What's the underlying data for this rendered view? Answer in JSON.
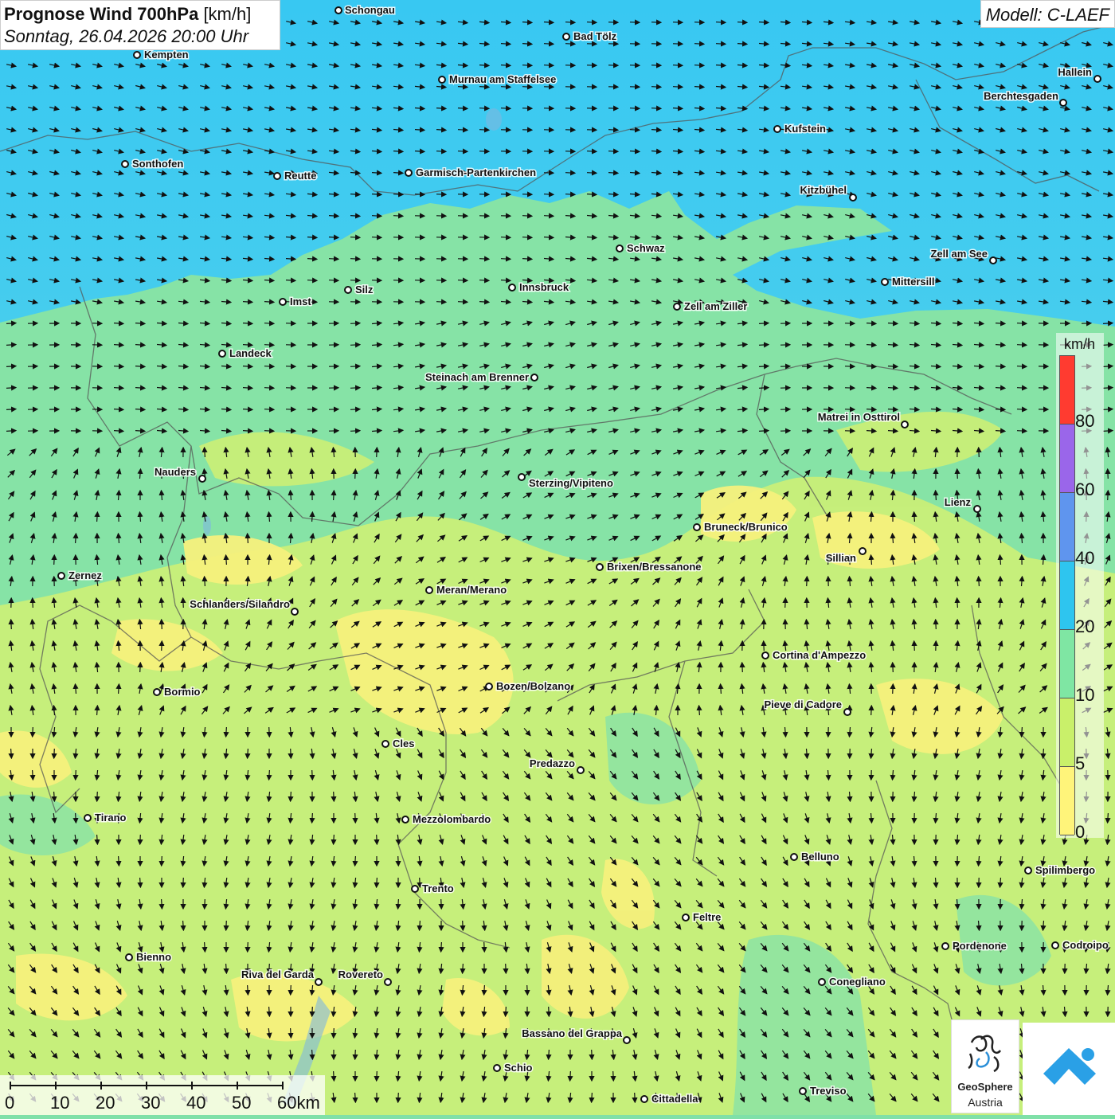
{
  "title": {
    "main": "Prognose Wind 700hPa",
    "unit": "[km/h]",
    "date": "Sonntag, 26.04.2026 20:00 Uhr"
  },
  "model": "Modell: C-LAEF",
  "legend": {
    "unit": "km/h",
    "labels": [
      "80",
      "60",
      "40",
      "20",
      "10",
      "5",
      "0"
    ],
    "colors": [
      "#ff3b30",
      "#9a66ea",
      "#5f95ee",
      "#2ec5ef",
      "#7fe6a3",
      "#c9f06a",
      "#fff47a"
    ]
  },
  "scale_bar": {
    "labels": [
      "0",
      "10",
      "20",
      "30",
      "40",
      "50",
      "60km"
    ]
  },
  "cities": [
    {
      "name": "Schongau"
    },
    {
      "name": "Bad Tölz"
    },
    {
      "name": "Kempten"
    },
    {
      "name": "Murnau am Staffelsee"
    },
    {
      "name": "Hallein"
    },
    {
      "name": "Berchtesgaden"
    },
    {
      "name": "Kufstein"
    },
    {
      "name": "Sonthofen"
    },
    {
      "name": "Reutte"
    },
    {
      "name": "Garmisch-Partenkirchen"
    },
    {
      "name": "Kitzbühel"
    },
    {
      "name": "Schwaz"
    },
    {
      "name": "Zell am See"
    },
    {
      "name": "Mittersill"
    },
    {
      "name": "Innsbruck"
    },
    {
      "name": "Silz"
    },
    {
      "name": "Imst"
    },
    {
      "name": "Zell am Ziller"
    },
    {
      "name": "Landeck"
    },
    {
      "name": "Steinach am Brenner"
    },
    {
      "name": "Matrei in Osttirol"
    },
    {
      "name": "Nauders"
    },
    {
      "name": "Sterzing/Vipiteno"
    },
    {
      "name": "Lienz"
    },
    {
      "name": "Bruneck/Brunico"
    },
    {
      "name": "Sillian"
    },
    {
      "name": "Zernez"
    },
    {
      "name": "Brixen/Bressanone"
    },
    {
      "name": "Meran/Merano"
    },
    {
      "name": "Schlanders/Silandro"
    },
    {
      "name": "Cortina d'Ampezzo"
    },
    {
      "name": "Bozen/Bolzano"
    },
    {
      "name": "Bormio"
    },
    {
      "name": "Pieve di Cadore"
    },
    {
      "name": "Cles"
    },
    {
      "name": "Predazzo"
    },
    {
      "name": "Tirano"
    },
    {
      "name": "Mezzolombardo"
    },
    {
      "name": "Belluno"
    },
    {
      "name": "Spilimbergo"
    },
    {
      "name": "Trento"
    },
    {
      "name": "Feltre"
    },
    {
      "name": "Pordenone"
    },
    {
      "name": "Codroipo"
    },
    {
      "name": "Bienno"
    },
    {
      "name": "Riva del Garda"
    },
    {
      "name": "Rovereto"
    },
    {
      "name": "Conegliano"
    },
    {
      "name": "Bassano del Grappa"
    },
    {
      "name": "Schio"
    },
    {
      "name": "Treviso"
    },
    {
      "name": "Cittadella"
    }
  ],
  "logo": {
    "name": "GeoSphere",
    "sub": "Austria"
  }
}
